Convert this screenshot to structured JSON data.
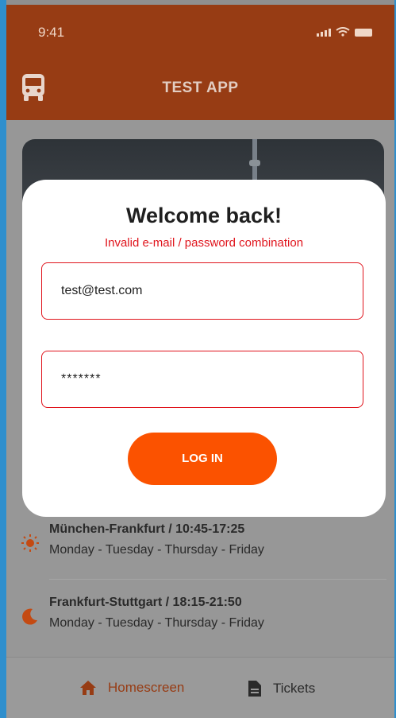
{
  "status_bar": {
    "time": "9:41"
  },
  "header": {
    "title": "TEST APP"
  },
  "routes": [
    {
      "title": "München-Frankfurt /  10:45-17:25",
      "days": "Monday - Tuesday - Thursday - Friday",
      "icon": "sun-icon"
    },
    {
      "title": "Frankfurt-Stuttgart /  18:15-21:50",
      "days": "Monday - Tuesday - Thursday - Friday",
      "icon": "moon-icon"
    }
  ],
  "tabs": [
    {
      "label": "Homescreen",
      "icon": "home-icon",
      "active": true
    },
    {
      "label": "Tickets",
      "icon": "document-icon",
      "active": false
    }
  ],
  "login": {
    "title": "Welcome back!",
    "error": "Invalid e-mail / password combination",
    "email_value": "test@test.com",
    "password_value": "*******",
    "button_label": "LOG IN"
  },
  "colors": {
    "header_bg": "#973c14",
    "accent": "#fb5200",
    "error": "#e0141c",
    "active_tab": "#973c14"
  }
}
